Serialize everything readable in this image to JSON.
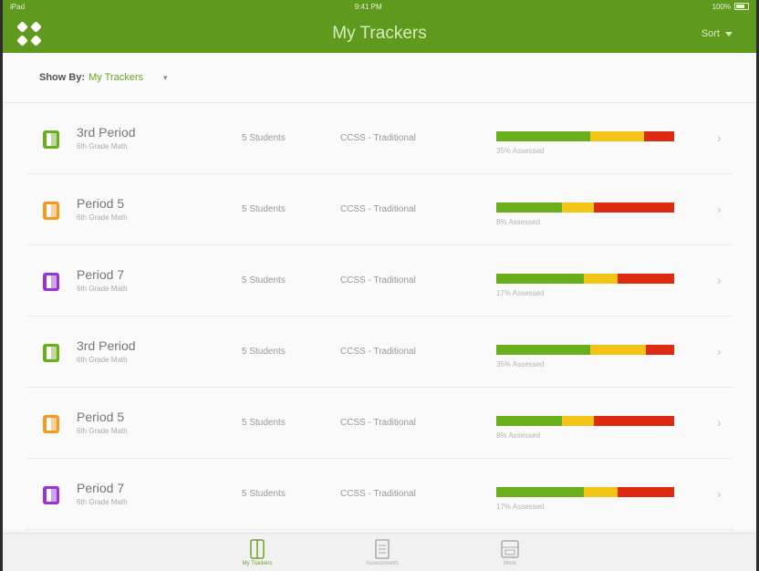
{
  "status_bar": {
    "carrier": "iPad",
    "time": "9:41 PM",
    "battery": "100%"
  },
  "header": {
    "title": "My Trackers",
    "sort_label": "Sort"
  },
  "filter": {
    "label": "Show By:",
    "value": "My Trackers"
  },
  "colors": {
    "accent": "#5f9a1e",
    "green": "#6aae1c",
    "yellow": "#f2c415",
    "red": "#dd2b11",
    "orange": "#f39a1f",
    "purple": "#9b32d6"
  },
  "rows": [
    {
      "name": "3rd Period",
      "subject": "6th Grade Math",
      "students": "5 Students",
      "method": "CCSS - Traditional",
      "progress_label": "35% Assessed",
      "icon_color": "#6aae1c",
      "segments": [
        0.53,
        0.3,
        0.17
      ]
    },
    {
      "name": "Period 5",
      "subject": "6th Grade Math",
      "students": "5 Students",
      "method": "CCSS - Traditional",
      "progress_label": "8% Assessed",
      "icon_color": "#f39a1f",
      "segments": [
        0.37,
        0.18,
        0.45
      ]
    },
    {
      "name": "Period 7",
      "subject": "6th Grade Math",
      "students": "5 Students",
      "method": "CCSS - Traditional",
      "progress_label": "17% Assessed",
      "icon_color": "#9b32d6",
      "segments": [
        0.49,
        0.19,
        0.32
      ]
    },
    {
      "name": "3rd Period",
      "subject": "6th Grade Math",
      "students": "5 Students",
      "method": "CCSS - Traditional",
      "progress_label": "35% Assessed",
      "icon_color": "#6aae1c",
      "segments": [
        0.53,
        0.31,
        0.16
      ]
    },
    {
      "name": "Period 5",
      "subject": "6th Grade Math",
      "students": "5 Students",
      "method": "CCSS - Traditional",
      "progress_label": "8% Assessed",
      "icon_color": "#f39a1f",
      "segments": [
        0.37,
        0.18,
        0.45
      ]
    },
    {
      "name": "Period 7",
      "subject": "6th Grade Math",
      "students": "5 Students",
      "method": "CCSS - Traditional",
      "progress_label": "17% Assessed",
      "icon_color": "#9b32d6",
      "segments": [
        0.49,
        0.19,
        0.32
      ]
    }
  ],
  "tabs": [
    {
      "label": "My Trackers",
      "icon": "tracker-icon",
      "active": true
    },
    {
      "label": "Assessments",
      "icon": "assessment-icon",
      "active": false
    },
    {
      "label": "More",
      "icon": "more-icon",
      "active": false
    }
  ]
}
